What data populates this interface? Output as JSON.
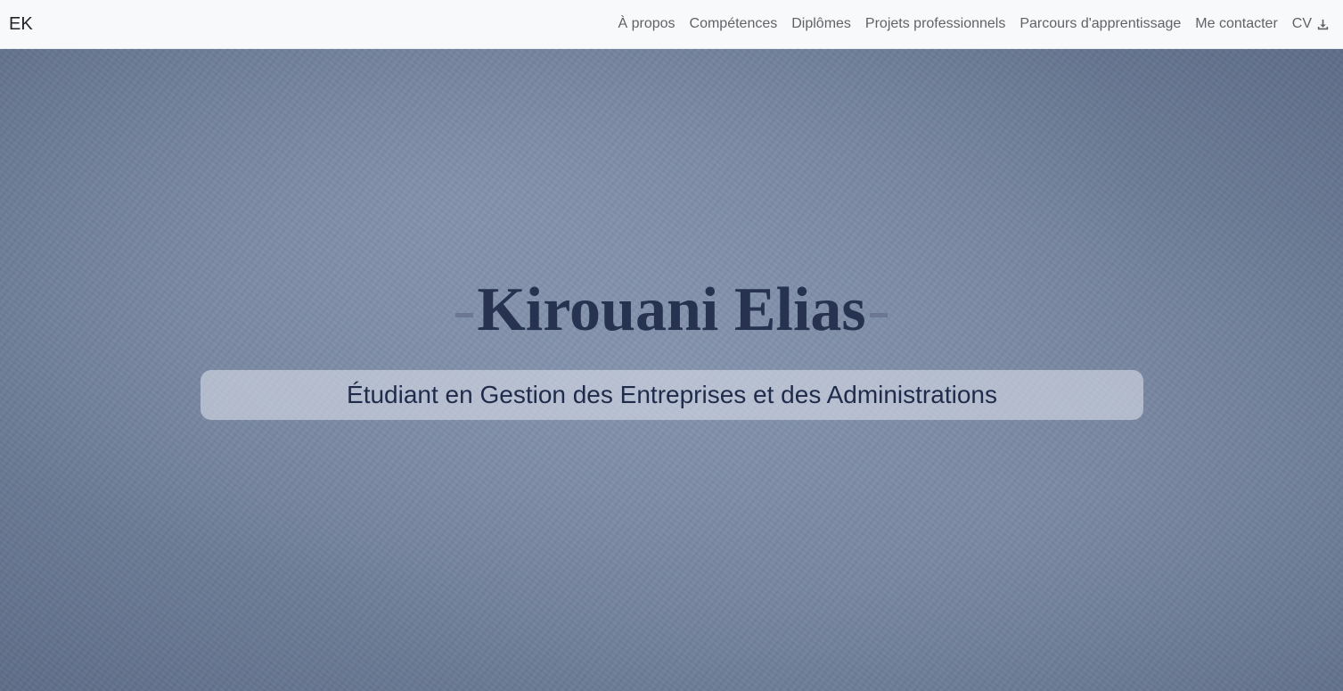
{
  "navbar": {
    "brand": "EK",
    "links": [
      {
        "label": "À propos"
      },
      {
        "label": "Compétences"
      },
      {
        "label": "Diplômes"
      },
      {
        "label": "Projets professionnels"
      },
      {
        "label": "Parcours d'apprentissage"
      },
      {
        "label": "Me contacter"
      },
      {
        "label": "CV",
        "icon": "download-icon"
      }
    ]
  },
  "hero": {
    "name": "Kirouani Elias",
    "tagline": "Étudiant en Gestion des Entreprises et des Administrations"
  },
  "colors": {
    "navbar_bg": "#f8f9fa",
    "hero_bg": "#7b8aa5",
    "title_color": "#26324f"
  }
}
